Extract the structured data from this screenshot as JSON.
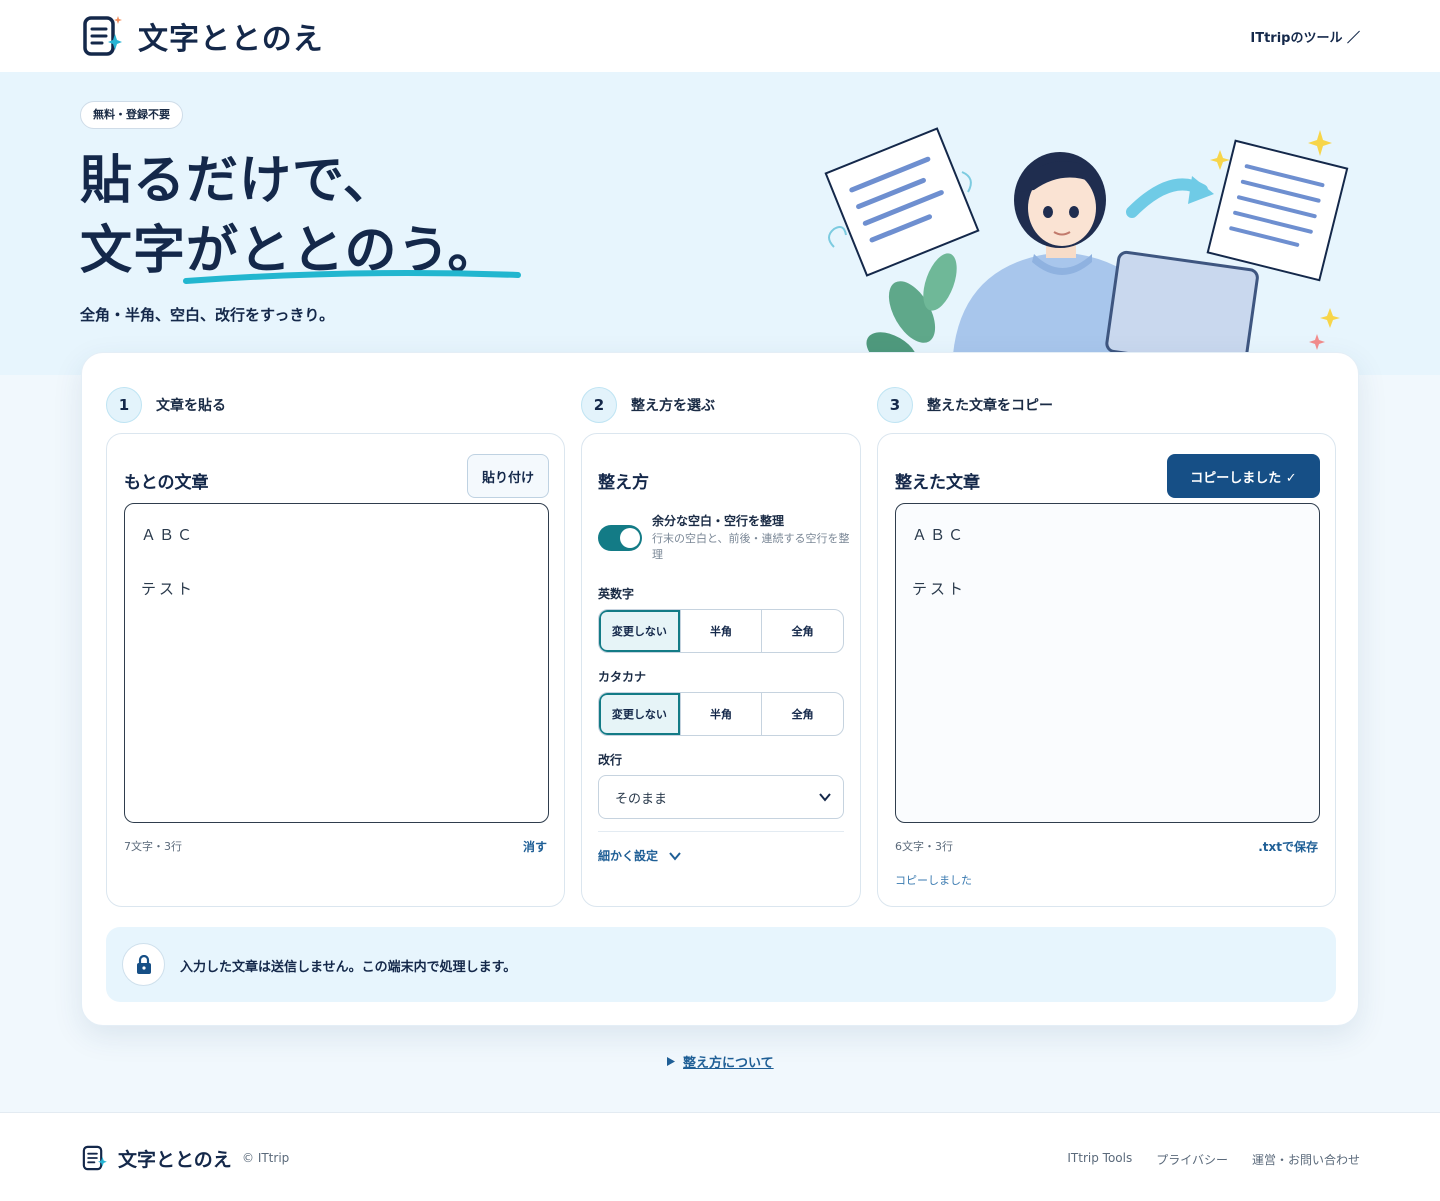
{
  "header": {
    "app_title": "文字ととのえ",
    "nav_link": "ITtripのツール ／"
  },
  "hero": {
    "badge": "無料・登録不要",
    "title_line1": "貼るだけで、",
    "title_line2": "文字がととのう。",
    "subtitle": "全角・半角、空白、改行をすっきり。"
  },
  "steps": [
    {
      "num": "1",
      "label": "文章を貼る"
    },
    {
      "num": "2",
      "label": "整え方を選ぶ"
    },
    {
      "num": "3",
      "label": "整えた文章をコピー"
    }
  ],
  "input_panel": {
    "title": "もとの文章",
    "paste_button": "貼り付け",
    "text_lines": [
      "ＡＢＣ",
      "",
      "テスト"
    ],
    "count": "7文字・3行",
    "clear_link": "消す"
  },
  "options_panel": {
    "title": "整え方",
    "toggle": {
      "label": "余分な空白・空行を整理",
      "description": "行末の空白と、前後・連続する空行を整理",
      "on": true
    },
    "alnum": {
      "label": "英数字",
      "options": [
        "変更しない",
        "半角",
        "全角"
      ],
      "selected": "変更しない"
    },
    "katakana": {
      "label": "カタカナ",
      "options": [
        "変更しない",
        "半角",
        "全角"
      ],
      "selected": "変更しない"
    },
    "linebreak": {
      "label": "改行",
      "value": "そのまま"
    },
    "advanced_link": "細かく設定"
  },
  "output_panel": {
    "title": "整えた文章",
    "copy_button": "コピーしました ✓",
    "text_lines": [
      "ＡＢＣ",
      "",
      "テスト"
    ],
    "count": "6文字・3行",
    "save_link": ".txtで保存",
    "status": "コピーしました"
  },
  "notice": {
    "text": "入力した文章は送信しません。この端末内で処理します。"
  },
  "about_link": "整え方について",
  "footer": {
    "app_title": "文字ととのえ",
    "copyright": "© ITtrip",
    "links": [
      "ITtrip Tools",
      "プライバシー",
      "運営・お問い合わせ"
    ]
  },
  "colors": {
    "primary": "#164f86",
    "accent": "#137b86",
    "hero_bg": "#e7f5fd",
    "text": "#14284a"
  }
}
